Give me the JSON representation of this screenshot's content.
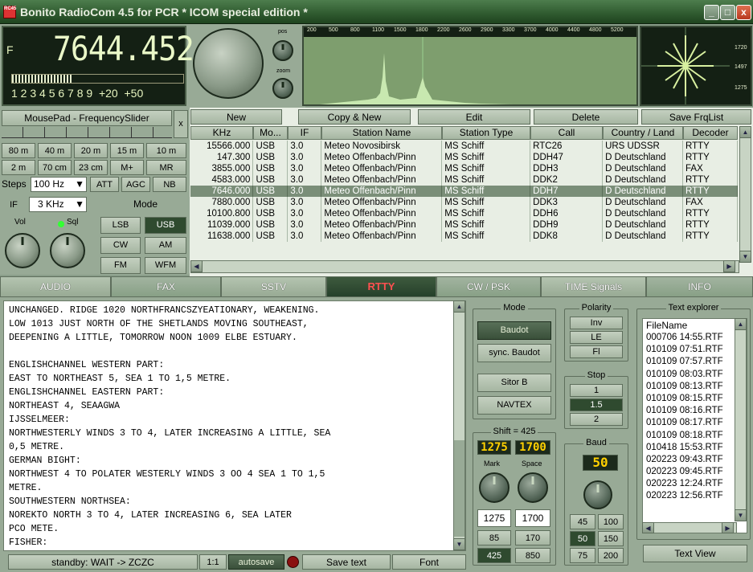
{
  "window": {
    "title": "Bonito RadioCom 4.5  for PCR  * ICOM special edition *",
    "icon_text": "RC45",
    "buttons": [
      "_",
      "□",
      "x"
    ]
  },
  "frequency": {
    "label": "F",
    "value": "7644.452"
  },
  "s_meter": {
    "scale": "1 2 3 4 5 6 7 8 9  +20  +50",
    "level": 0.35
  },
  "knobs": {
    "pos": "pos",
    "zoom": "zoom"
  },
  "spectrum": {
    "scale": [
      "200",
      "500",
      "800",
      "1100",
      "1500",
      "1800",
      "2200",
      "2600",
      "2900",
      "3300",
      "3700",
      "4000",
      "4400",
      "4800",
      "5200"
    ]
  },
  "scope": {
    "labels": [
      "1720",
      "1497",
      "1275"
    ]
  },
  "slider": {
    "label": "MousePad - FrequencySlider",
    "close": "x"
  },
  "bands": {
    "row1": [
      "80 m",
      "40 m",
      "20 m",
      "15 m",
      "10 m"
    ],
    "row2": [
      "2 m",
      "70 cm",
      "23 cm",
      "M+",
      "MR"
    ]
  },
  "controls": {
    "steps_label": "Steps",
    "steps_value": "100 Hz",
    "att": "ATT",
    "agc": "AGC",
    "nb": "NB",
    "if_label": "IF",
    "if_value": "3 KHz",
    "mode_label": "Mode",
    "vol": "Vol",
    "sql": "Sql",
    "modes": [
      "LSB",
      "USB",
      "CW",
      "AM",
      "FM",
      "WFM"
    ],
    "selected_mode": "USB"
  },
  "toolbar": {
    "new": "New",
    "copy_new": "Copy & New",
    "edit": "Edit",
    "delete": "Delete",
    "save": "Save FrqList"
  },
  "table": {
    "columns": [
      "KHz",
      "Mo...",
      "IF",
      "Station Name",
      "Station Type",
      "Call",
      "Country / Land",
      "Decoder"
    ],
    "rows": [
      [
        "15566.000",
        "USB",
        "3.0",
        "Meteo Novosibirsk",
        "MS Schiff",
        "RTC26",
        "URS UDSSR",
        "RTTY"
      ],
      [
        "147.300",
        "USB",
        "3.0",
        "Meteo Offenbach/Pinn",
        "MS Schiff",
        "DDH47",
        "D   Deutschland",
        "RTTY"
      ],
      [
        "3855.000",
        "USB",
        "3.0",
        "Meteo Offenbach/Pinn",
        "MS Schiff",
        "DDH3",
        "D   Deutschland",
        "FAX"
      ],
      [
        "4583.000",
        "USB",
        "3.0",
        "Meteo Offenbach/Pinn",
        "MS Schiff",
        "DDK2",
        "D   Deutschland",
        "RTTY"
      ],
      [
        "7646.000",
        "USB",
        "3.0",
        "Meteo Offenbach/Pinn",
        "MS Schiff",
        "DDH7",
        "D   Deutschland",
        "RTTY"
      ],
      [
        "7880.000",
        "USB",
        "3.0",
        "Meteo Offenbach/Pinn",
        "MS Schiff",
        "DDK3",
        "D   Deutschland",
        "FAX"
      ],
      [
        "10100.800",
        "USB",
        "3.0",
        "Meteo Offenbach/Pinn",
        "MS Schiff",
        "DDH6",
        "D   Deutschland",
        "RTTY"
      ],
      [
        "11039.000",
        "USB",
        "3.0",
        "Meteo Offenbach/Pinn",
        "MS Schiff",
        "DDH9",
        "D   Deutschland",
        "RTTY"
      ],
      [
        "11638.000",
        "USB",
        "3.0",
        "Meteo Offenbach/Pinn",
        "MS Schiff",
        "DDK8",
        "D   Deutschland",
        "RTTY"
      ]
    ],
    "selected_row": 4
  },
  "tabs": [
    "AUDIO",
    "FAX",
    "SSTV",
    "RTTY",
    "CW / PSK",
    "TIME Signals",
    "INFO"
  ],
  "active_tab": "RTTY",
  "rtty_text": "UNCHANGED. RIDGE 1020 NORTHFRANCSZYEATIONARY, WEAKENING.\nLOW 1013 JUST NORTH OF THE SHETLANDS MOVING SOUTHEAST,\nDEEPENING A LITTLE, TOMORROW NOON 1009 ELBE ESTUARY.\n\nENGLISHCHANNEL WESTERN PART:\nEAST TO NORTHEAST 5, SEA 1 TO 1,5 METRE.\nENGLISHCHANNEL EASTERN PART:\nNORTHEAST 4, SEAAGWA\nIJSSELMEER:\nNORTHWESTERLY WINDS 3 TO 4, LATER INCREASING A LITTLE, SEA\n0,5 METRE.\nGERMAN BIGHT:\nNORTHWEST 4 TO POLATER WESTERLY WINDS 3 OO 4 SEA 1 TO 1,5\nMETRE.\nSOUTHWESTERN NORTHSEA:\nNOREKTO NORTH 3 TO 4, LATER INCREASING 6, SEA LATER\nPCO METE.\nFISHER:",
  "mode_group": {
    "title": "Mode",
    "baudot": "Baudot",
    "sync": "sync. Baudot",
    "sitor": "Sitor B",
    "navtex": "NAVTEX"
  },
  "polarity": {
    "title": "Polarity",
    "inv": "Inv",
    "le": "LE",
    "fl": "Fl"
  },
  "stop": {
    "title": "Stop",
    "values": [
      "1",
      "1.5",
      "2"
    ],
    "selected": "1.5"
  },
  "shift": {
    "title": "Shift = 425",
    "mark_disp": "1275",
    "space_disp": "1700",
    "mark": "Mark",
    "space": "Space",
    "mark_val": "1275",
    "space_val": "1700",
    "presets": [
      "85",
      "170",
      "425",
      "850"
    ]
  },
  "baud": {
    "title": "Baud",
    "display": "50",
    "values": [
      "45",
      "100",
      "50",
      "150",
      "75",
      "200"
    ],
    "selected": "50"
  },
  "explorer": {
    "title": "Text explorer",
    "header": "FileName",
    "files": [
      "000706 14:55.RTF",
      "010109 07:51.RTF",
      "010109 07:57.RTF",
      "010109 08:03.RTF",
      "010109 08:13.RTF",
      "010109 08:15.RTF",
      "010109 08:16.RTF",
      "010109 08:17.RTF",
      "010109 08:18.RTF",
      "010418 15:53.RTF",
      "020223 09:43.RTF",
      "020223 09:45.RTF",
      "020223 12:24.RTF",
      "020223 12:56.RTF"
    ],
    "view": "Text View"
  },
  "status": {
    "state": "standby: WAIT -> ZCZC",
    "ratio": "1:1",
    "autosave": "autosave",
    "save_text": "Save text",
    "font": "Font"
  }
}
